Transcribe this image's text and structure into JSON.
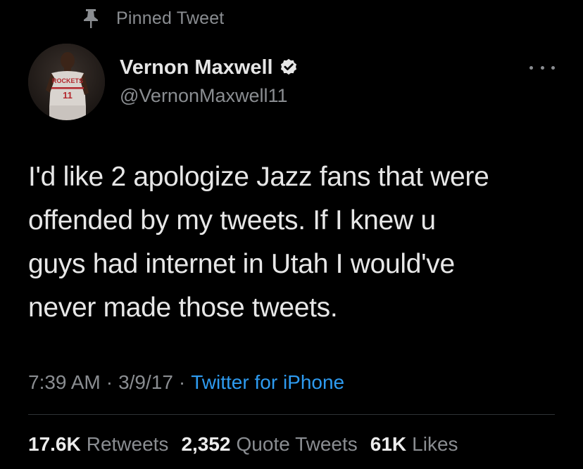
{
  "pinned": {
    "label": "Pinned Tweet",
    "icon": "pin-icon"
  },
  "author": {
    "display_name": "Vernon Maxwell",
    "handle": "@VernonMaxwell11",
    "verified_icon": "verified-badge-icon",
    "avatar_jersey_text": "ROCKETS",
    "avatar_jersey_number": "11"
  },
  "more_icon": "more-options-icon",
  "tweet": {
    "lines": [
      "I'd like 2 apologize Jazz fans that were",
      "offended by my tweets. If I knew u",
      "guys had internet in Utah I would've",
      "never made those tweets."
    ]
  },
  "meta": {
    "time": "7:39 AM",
    "separator": "·",
    "date": "3/9/17",
    "source": "Twitter for iPhone"
  },
  "stats": {
    "retweets_value": "17.6K",
    "retweets_label": "Retweets",
    "quotes_value": "2,352",
    "quotes_label": "Quote Tweets",
    "likes_value": "61K",
    "likes_label": "Likes"
  },
  "colors": {
    "background": "#000000",
    "text_primary": "#e7e7e7",
    "text_secondary": "#8a8d91",
    "link": "#2e9bf0",
    "divider": "#2f3336"
  }
}
